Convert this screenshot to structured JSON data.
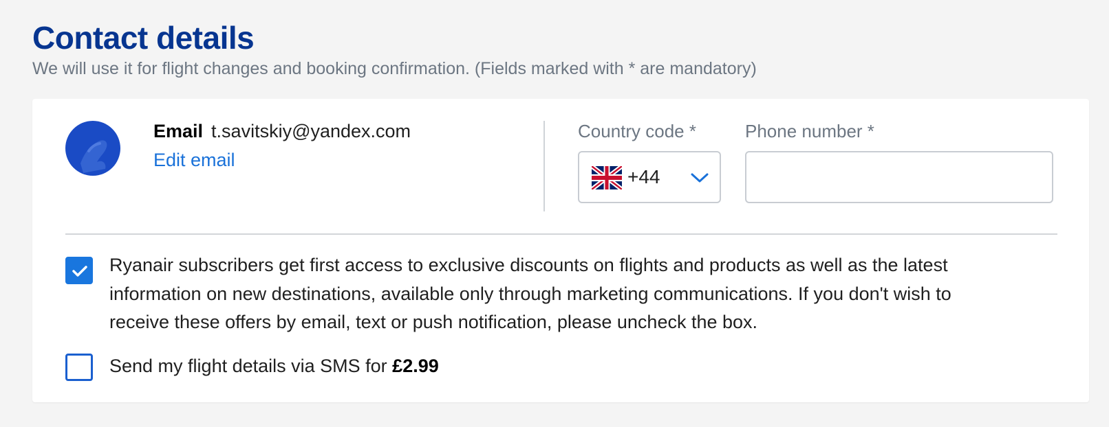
{
  "header": {
    "title": "Contact details",
    "subtitle": "We will use it for flight changes and booking confirmation.  (Fields marked with * are mandatory)"
  },
  "account": {
    "avatar_icon": "ryanair-harp-logo-icon",
    "email_label": "Email",
    "email_value": "t.savitskiy@yandex.com",
    "edit_email_label": "Edit email"
  },
  "phone": {
    "country_code_label": "Country code *",
    "country_flag": "uk-flag-icon",
    "country_code_value": "+44",
    "phone_number_label": "Phone number *",
    "phone_number_value": "",
    "phone_number_placeholder": ""
  },
  "options": {
    "marketing": {
      "checked": true,
      "text": "Ryanair subscribers get first access to exclusive discounts on flights and products as well as the latest information on new destinations, available only through marketing communications. If you don't wish to receive these offers by email, text or push notification, please uncheck the box."
    },
    "sms": {
      "checked": false,
      "text": "Send my flight details via SMS for ",
      "price": "£2.99"
    }
  },
  "colors": {
    "title": "#073590",
    "link": "#1971d9",
    "checkbox": "#1976de",
    "avatar": "#1a4bc5",
    "page_background": "#f4f4f4"
  }
}
